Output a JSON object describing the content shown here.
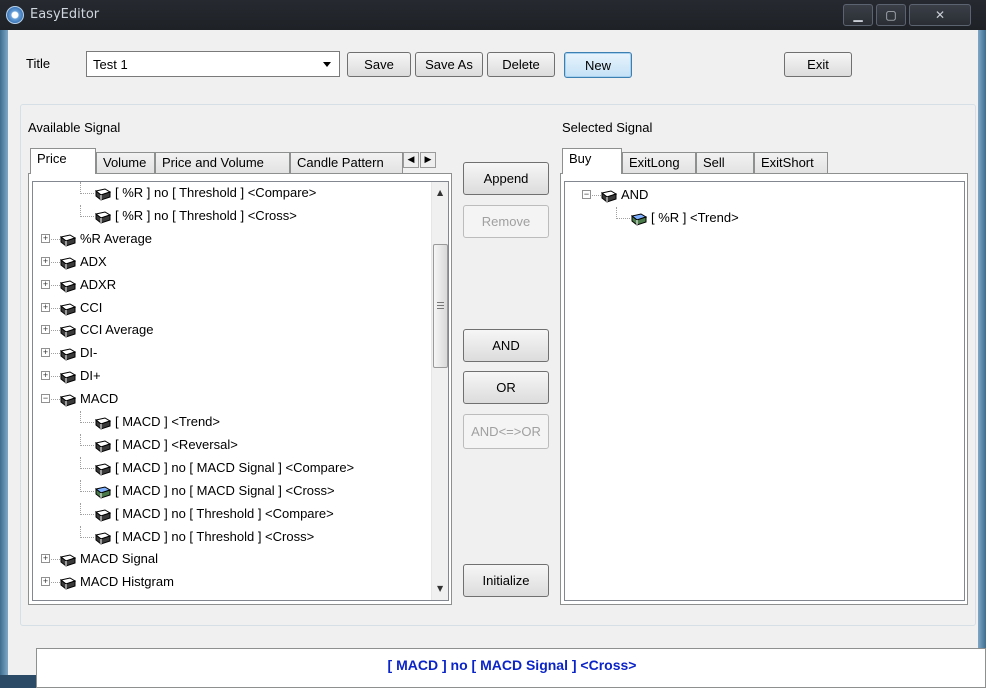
{
  "window": {
    "title": "EasyEditor",
    "controls": [
      "▁",
      "▢",
      "✕"
    ]
  },
  "toolbar": {
    "title_label": "Title",
    "title_value": "Test 1",
    "save": "Save",
    "save_as": "Save As",
    "delete": "Delete",
    "new": "New",
    "exit": "Exit"
  },
  "available": {
    "label": "Available Signal",
    "tabs": [
      "Price",
      "Volume",
      "Price and Volume",
      "Candle Pattern"
    ],
    "rows": [
      {
        "text": "[ %R ] no [ Threshold ] <Compare>",
        "level": 2,
        "expander": "",
        "icon": "book-icon"
      },
      {
        "text": "[ %R ] no [ Threshold ] <Cross>",
        "level": 2,
        "expander": "",
        "icon": "book-icon"
      },
      {
        "text": "%R Average",
        "level": 1,
        "expander": "+",
        "icon": "book-icon"
      },
      {
        "text": "ADX",
        "level": 1,
        "expander": "+",
        "icon": "book-icon"
      },
      {
        "text": "ADXR",
        "level": 1,
        "expander": "+",
        "icon": "book-icon"
      },
      {
        "text": "CCI",
        "level": 1,
        "expander": "+",
        "icon": "book-icon"
      },
      {
        "text": "CCI Average",
        "level": 1,
        "expander": "+",
        "icon": "book-icon"
      },
      {
        "text": "DI-",
        "level": 1,
        "expander": "+",
        "icon": "book-icon"
      },
      {
        "text": "DI+",
        "level": 1,
        "expander": "+",
        "icon": "book-icon"
      },
      {
        "text": "MACD",
        "level": 1,
        "expander": "−",
        "icon": "book-icon"
      },
      {
        "text": "[ MACD ] <Trend>",
        "level": 2,
        "expander": "",
        "icon": "book-icon"
      },
      {
        "text": "[ MACD ] <Reversal>",
        "level": 2,
        "expander": "",
        "icon": "book-icon"
      },
      {
        "text": "[ MACD ] no [ MACD Signal ] <Compare>",
        "level": 2,
        "expander": "",
        "icon": "book-icon"
      },
      {
        "text": "[ MACD ] no [ MACD Signal ] <Cross>",
        "level": 2,
        "expander": "",
        "icon": "selected-book-icon"
      },
      {
        "text": "[ MACD ] no [ Threshold ] <Compare>",
        "level": 2,
        "expander": "",
        "icon": "book-icon"
      },
      {
        "text": "[ MACD ] no [ Threshold ] <Cross>",
        "level": 2,
        "expander": "",
        "icon": "book-icon"
      },
      {
        "text": "MACD Signal",
        "level": 1,
        "expander": "+",
        "icon": "book-icon"
      },
      {
        "text": "MACD Histgram",
        "level": 1,
        "expander": "+",
        "icon": "book-icon"
      }
    ]
  },
  "middle": {
    "append": "Append",
    "remove": "Remove",
    "and": "AND",
    "or": "OR",
    "and_or": "AND<=>OR",
    "initialize": "Initialize"
  },
  "selected": {
    "label": "Selected Signal",
    "tabs": [
      "Buy",
      "ExitLong",
      "Sell",
      "ExitShort"
    ],
    "rows": [
      {
        "text": "AND",
        "level": 1,
        "expander": "−",
        "icon": "book-icon"
      },
      {
        "text": "[ %R ] <Trend>",
        "level": 2,
        "expander": "",
        "icon": "selected-book-icon"
      }
    ]
  },
  "status": {
    "text": "[ MACD ] no [ MACD Signal ] <Cross>"
  }
}
